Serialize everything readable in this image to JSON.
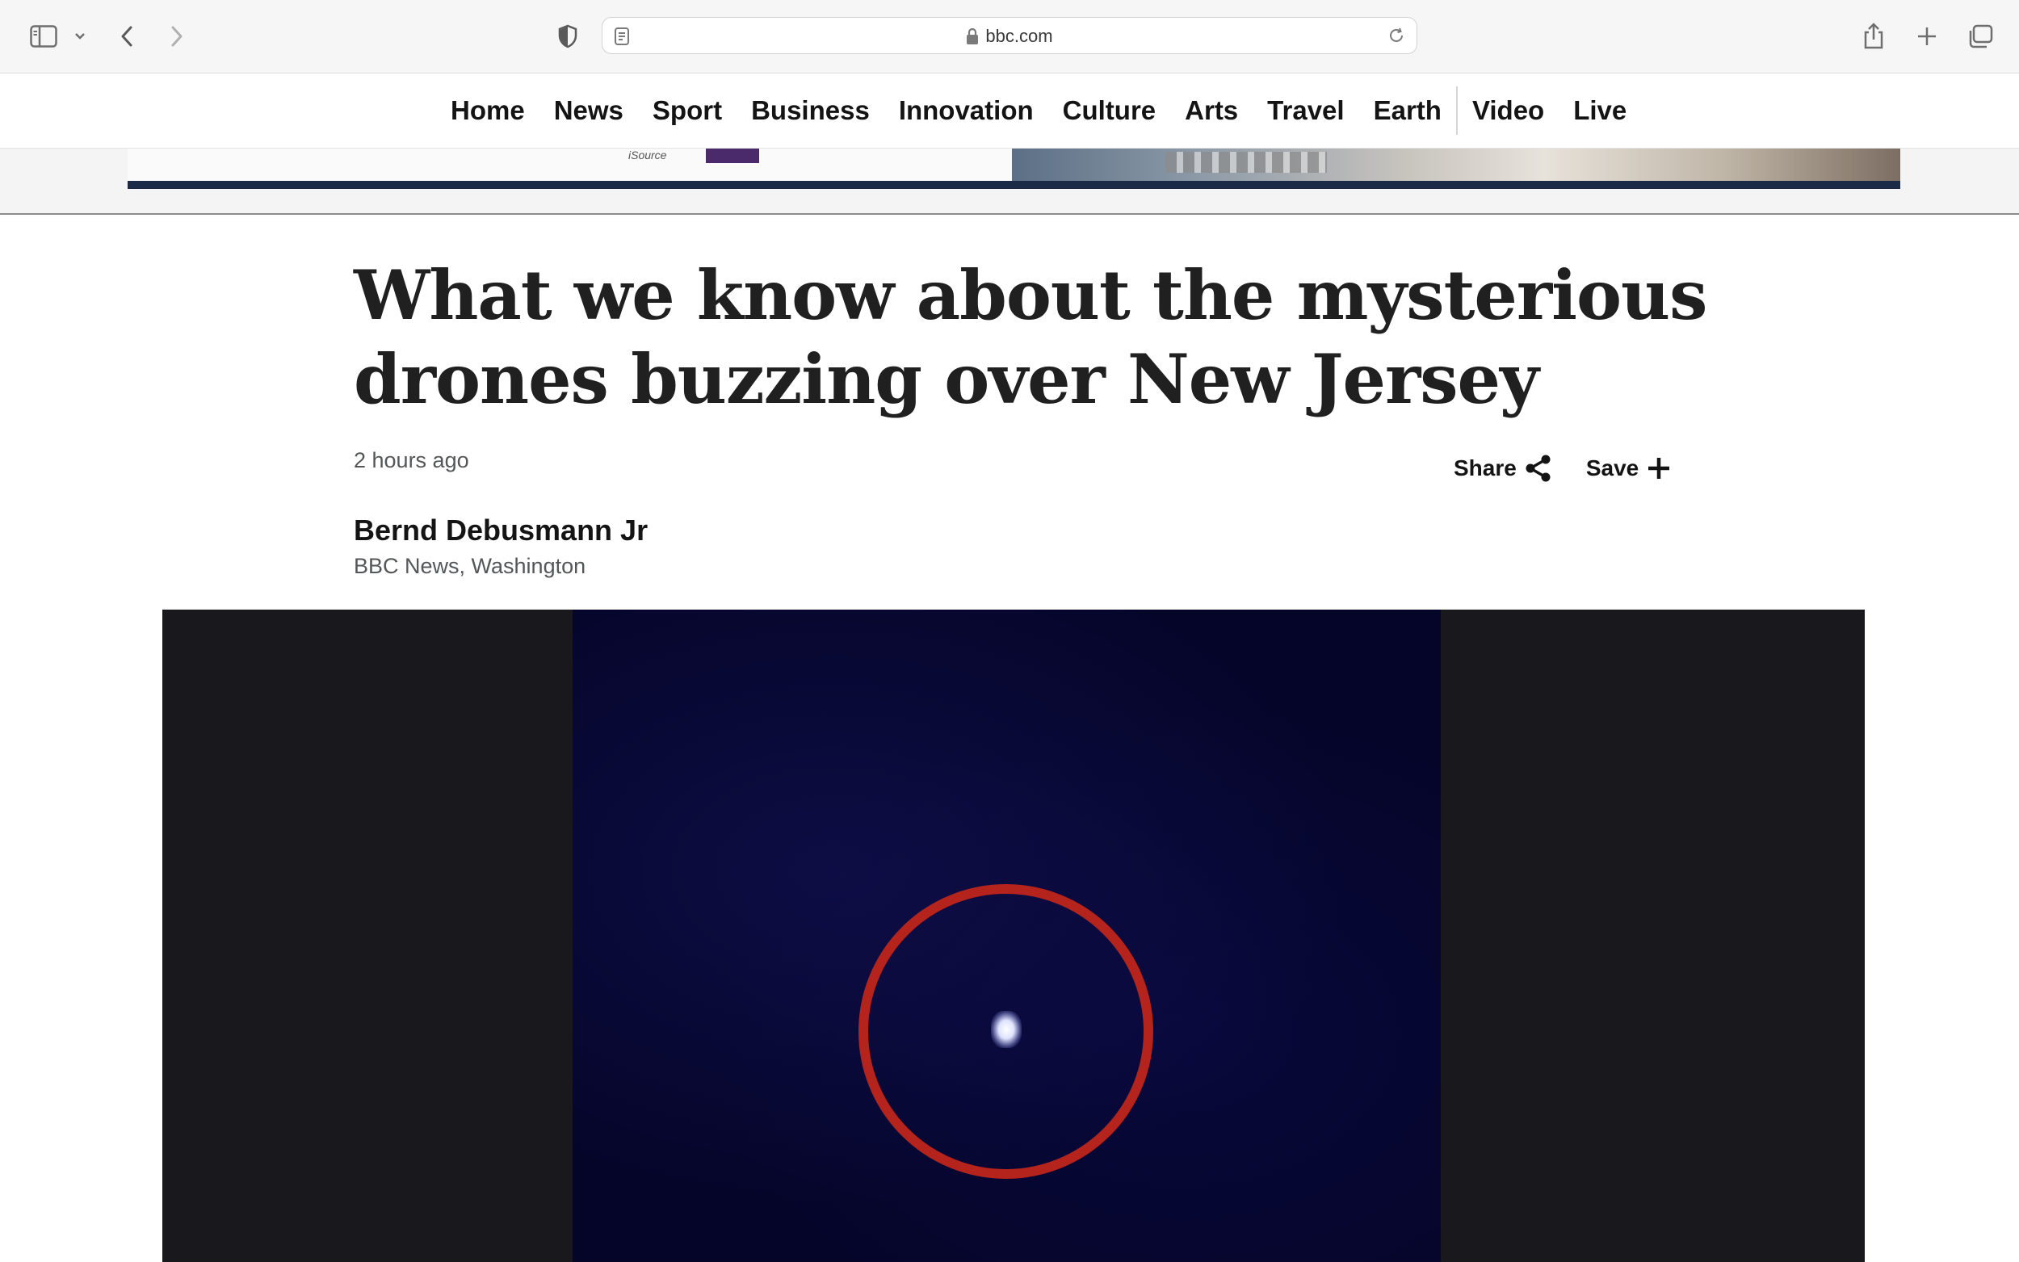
{
  "browser": {
    "url": "bbc.com"
  },
  "nav": {
    "items": [
      "Home",
      "News",
      "Sport",
      "Business",
      "Innovation",
      "Culture",
      "Arts",
      "Travel",
      "Earth",
      "Video",
      "Live"
    ]
  },
  "ad": {
    "logo_text": "iSource"
  },
  "article": {
    "headline": "What we know about the mysterious drones buzzing over New Jersey",
    "timestamp": "2 hours ago",
    "share_label": "Share",
    "save_label": "Save",
    "author": "Bernd Debusmann Jr",
    "author_role": "BBC News, Washington"
  },
  "colors": {
    "ring": "#b4231c",
    "ad_bar": "#1b2a47"
  }
}
